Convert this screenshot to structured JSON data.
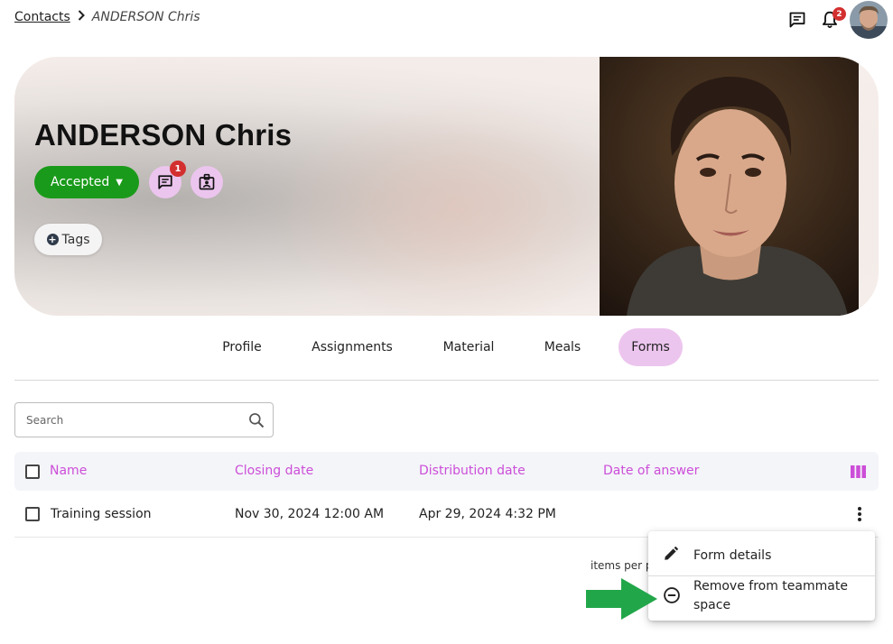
{
  "breadcrumb": {
    "parent": "Contacts",
    "current": "ANDERSON Chris"
  },
  "topbar": {
    "notification_count": "2"
  },
  "contact": {
    "name": "ANDERSON Chris",
    "status": "Accepted",
    "messages_count": "1",
    "tags_label": "Tags"
  },
  "tabs": [
    {
      "label": "Profile"
    },
    {
      "label": "Assignments"
    },
    {
      "label": "Material"
    },
    {
      "label": "Meals"
    },
    {
      "label": "Forms",
      "active": true
    }
  ],
  "search": {
    "placeholder": "Search"
  },
  "table": {
    "columns": [
      "Name",
      "Closing date",
      "Distribution date",
      "Date of answer"
    ],
    "rows": [
      {
        "name": "Training session",
        "closing_date": "Nov 30, 2024 12:00 AM",
        "distribution_date": "Apr 29, 2024 4:32 PM",
        "date_of_answer": ""
      }
    ]
  },
  "pagination": {
    "items_per_page_label": "items per p"
  },
  "context_menu": {
    "items": [
      {
        "label": "Form details",
        "icon": "pencil-icon"
      },
      {
        "label": "Remove from teammate space",
        "icon": "remove-circle-icon"
      }
    ]
  },
  "colors": {
    "accent": "#ecc5ee",
    "accepted": "#1a9a1a",
    "badge": "#d32f2f",
    "header_text": "#cc4ed8",
    "arrow": "#22a64a"
  }
}
